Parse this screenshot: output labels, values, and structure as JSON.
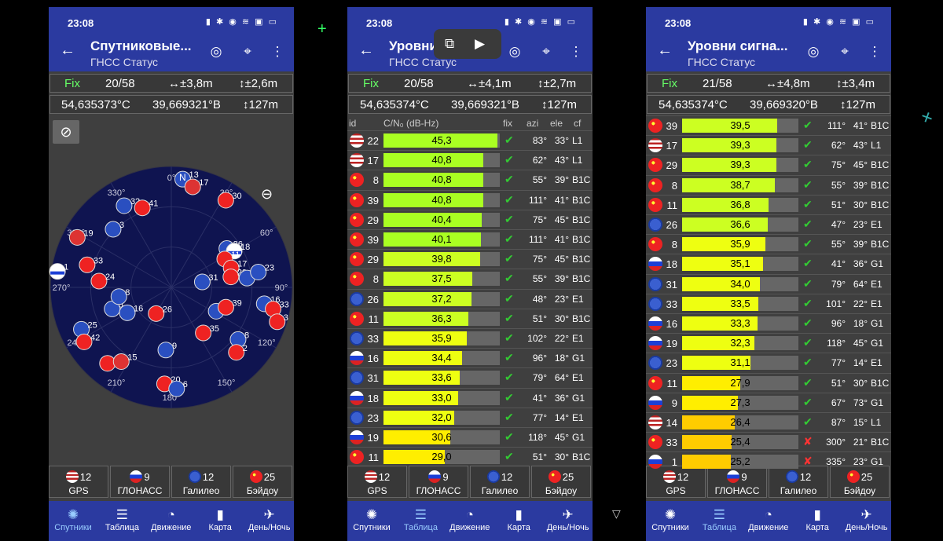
{
  "time": "23:08",
  "screens": [
    {
      "title": "Спутниковые...",
      "subtitle": "ГНСС Статус",
      "fix": {
        "label": "Fix",
        "count": "20/58",
        "h_acc": "↔±3,8m",
        "v_acc": "↕±2,6m"
      },
      "pos": {
        "lat": "54,635373°С",
        "lon": "39,669321°В",
        "alt": "↕127m"
      }
    },
    {
      "title": "Уровни",
      "subtitle": "ГНСС Статус",
      "fix": {
        "label": "Fix",
        "count": "20/58",
        "h_acc": "↔±4,1m",
        "v_acc": "↕±2,7m"
      },
      "pos": {
        "lat": "54,635374°С",
        "lon": "39,669321°В",
        "alt": "↕127m"
      }
    },
    {
      "title": "Уровни сигна...",
      "subtitle": "ГНСС Статус",
      "fix": {
        "label": "Fix",
        "count": "21/58",
        "h_acc": "↔±4,8m",
        "v_acc": "↕±3,4m"
      },
      "pos": {
        "lat": "54,635374°С",
        "lon": "39,669320°В",
        "alt": "↕127m"
      }
    }
  ],
  "table_headers": {
    "id": "id",
    "cn0": "C/N₀ (dB-Hz)",
    "fix": "fix",
    "azi": "azi",
    "ele": "ele",
    "cf": "cf"
  },
  "constellations": [
    {
      "name": "GPS",
      "flag": "us"
    },
    {
      "name": "ГЛОНАСС",
      "flag": "ru"
    },
    {
      "name": "Галилео",
      "flag": "eu"
    },
    {
      "name": "Бэйдоу",
      "flag": "cn"
    }
  ],
  "constellation_counts": [
    [
      "12",
      "9",
      "12",
      "25"
    ],
    [
      "12",
      "9",
      "12",
      "25"
    ],
    [
      "12",
      "9",
      "12",
      "25"
    ]
  ],
  "nav": [
    "Спутники",
    "Таблица",
    "Движение",
    "Карта",
    "День/Ночь"
  ],
  "nav_active": [
    0,
    1,
    1
  ],
  "sky": {
    "ring_labels": [
      "0°",
      "30°",
      "60°",
      "90°",
      "120°",
      "150°",
      "180°",
      "210°",
      "240°",
      "270°",
      "300°",
      "330°"
    ],
    "north": "N",
    "satellites": [
      {
        "id": "13",
        "f": "eu",
        "az": 6,
        "el": 90
      },
      {
        "id": "17",
        "f": "us",
        "az": 12,
        "el": 85
      },
      {
        "id": "32",
        "f": "eu",
        "az": 330,
        "el": 78
      },
      {
        "id": "41",
        "f": "cn",
        "az": 340,
        "el": 70
      },
      {
        "id": "30",
        "f": "cn",
        "az": 32,
        "el": 85
      },
      {
        "id": "3",
        "f": "eu",
        "az": 315,
        "el": 68
      },
      {
        "id": "19",
        "f": "us",
        "az": 298,
        "el": 88
      },
      {
        "id": "33",
        "f": "cn",
        "az": 285,
        "el": 72
      },
      {
        "id": "24",
        "f": "cn",
        "az": 275,
        "el": 60
      },
      {
        "id": "26",
        "f": "eu",
        "az": 55,
        "el": 56
      },
      {
        "id": "18",
        "f": "ru",
        "az": 60,
        "el": 60
      },
      {
        "id": "11",
        "f": "cn",
        "az": 62,
        "el": 50
      },
      {
        "id": "17",
        "f": "cn",
        "az": 72,
        "el": 52
      },
      {
        "id": "29",
        "f": "cn",
        "az": 80,
        "el": 50
      },
      {
        "id": "22",
        "f": "eu",
        "az": 83,
        "el": 63
      },
      {
        "id": "23",
        "f": "eu",
        "az": 80,
        "el": 73
      },
      {
        "id": "5",
        "f": "eu",
        "az": 250,
        "el": 52
      },
      {
        "id": "16",
        "f": "eu",
        "az": 240,
        "el": 42
      },
      {
        "id": "26",
        "f": "cn",
        "az": 210,
        "el": 25
      },
      {
        "id": "8",
        "f": "eu",
        "az": 260,
        "el": 44
      },
      {
        "id": "31",
        "f": "eu",
        "az": 80,
        "el": 26
      },
      {
        "id": "19",
        "f": "eu",
        "az": 118,
        "el": 42
      },
      {
        "id": "39",
        "f": "cn",
        "az": 110,
        "el": 48
      },
      {
        "id": "16",
        "f": "eu",
        "az": 100,
        "el": 78
      },
      {
        "id": "33",
        "f": "cn",
        "az": 102,
        "el": 86
      },
      {
        "id": "3",
        "f": "cn",
        "az": 108,
        "el": 92
      },
      {
        "id": "25",
        "f": "eu",
        "az": 245,
        "el": 82
      },
      {
        "id": "42",
        "f": "cn",
        "az": 238,
        "el": 85
      },
      {
        "id": "35",
        "f": "cn",
        "az": 145,
        "el": 46
      },
      {
        "id": "8",
        "f": "eu",
        "az": 128,
        "el": 70
      },
      {
        "id": "2",
        "f": "cn",
        "az": 135,
        "el": 76
      },
      {
        "id": "9",
        "f": "eu",
        "az": 185,
        "el": 52
      },
      {
        "id": "14",
        "f": "cn",
        "az": 220,
        "el": 82
      },
      {
        "id": "15",
        "f": "us",
        "az": 214,
        "el": 74
      },
      {
        "id": "20",
        "f": "cn",
        "az": 184,
        "el": 80
      },
      {
        "id": "6",
        "f": "eu",
        "az": 177,
        "el": 84
      },
      {
        "id": "1",
        "f": "ru",
        "az": 278,
        "el": 95
      }
    ]
  },
  "table2": [
    {
      "id": "22",
      "f": "us",
      "cn": 45.3,
      "cnt": "45,3",
      "fix": "✔",
      "az": "83°",
      "el": "33°",
      "cf": "L1"
    },
    {
      "id": "17",
      "f": "us",
      "cn": 40.8,
      "cnt": "40,8",
      "fix": "✔",
      "az": "62°",
      "el": "43°",
      "cf": "L1"
    },
    {
      "id": "8",
      "f": "cn",
      "cn": 40.8,
      "cnt": "40,8",
      "fix": "✔",
      "az": "55°",
      "el": "39°",
      "cf": "B1C"
    },
    {
      "id": "39",
      "f": "cn",
      "cn": 40.8,
      "cnt": "40,8",
      "fix": "✔",
      "az": "111°",
      "el": "41°",
      "cf": "B1C"
    },
    {
      "id": "29",
      "f": "cn",
      "cn": 40.4,
      "cnt": "40,4",
      "fix": "✔",
      "az": "75°",
      "el": "45°",
      "cf": "B1C"
    },
    {
      "id": "39",
      "f": "cn",
      "cn": 40.1,
      "cnt": "40,1",
      "fix": "✔",
      "az": "111°",
      "el": "41°",
      "cf": "B1C"
    },
    {
      "id": "29",
      "f": "cn",
      "cn": 39.8,
      "cnt": "39,8",
      "fix": "✔",
      "az": "75°",
      "el": "45°",
      "cf": "B1C"
    },
    {
      "id": "8",
      "f": "cn",
      "cn": 37.5,
      "cnt": "37,5",
      "fix": "✔",
      "az": "55°",
      "el": "39°",
      "cf": "B1C"
    },
    {
      "id": "26",
      "f": "eu",
      "cn": 37.2,
      "cnt": "37,2",
      "fix": "✔",
      "az": "48°",
      "el": "23°",
      "cf": "E1"
    },
    {
      "id": "11",
      "f": "cn",
      "cn": 36.3,
      "cnt": "36,3",
      "fix": "✔",
      "az": "51°",
      "el": "30°",
      "cf": "B1C"
    },
    {
      "id": "33",
      "f": "eu",
      "cn": 35.9,
      "cnt": "35,9",
      "fix": "✔",
      "az": "102°",
      "el": "22°",
      "cf": "E1"
    },
    {
      "id": "16",
      "f": "ru",
      "cn": 34.4,
      "cnt": "34,4",
      "fix": "✔",
      "az": "96°",
      "el": "18°",
      "cf": "G1"
    },
    {
      "id": "31",
      "f": "eu",
      "cn": 33.6,
      "cnt": "33,6",
      "fix": "✔",
      "az": "79°",
      "el": "64°",
      "cf": "E1"
    },
    {
      "id": "18",
      "f": "ru",
      "cn": 33.0,
      "cnt": "33,0",
      "fix": "✔",
      "az": "41°",
      "el": "36°",
      "cf": "G1"
    },
    {
      "id": "23",
      "f": "eu",
      "cn": 32.0,
      "cnt": "32,0",
      "fix": "✔",
      "az": "77°",
      "el": "14°",
      "cf": "E1"
    },
    {
      "id": "19",
      "f": "ru",
      "cn": 30.6,
      "cnt": "30,6",
      "fix": "✔",
      "az": "118°",
      "el": "45°",
      "cf": "G1"
    },
    {
      "id": "11",
      "f": "cn",
      "cn": 29.0,
      "cnt": "29,0",
      "fix": "✔",
      "az": "51°",
      "el": "30°",
      "cf": "B1C"
    }
  ],
  "table3": [
    {
      "id": "39",
      "f": "cn",
      "cn": 39.5,
      "cnt": "39,5",
      "fix": "✔",
      "az": "111°",
      "el": "41°",
      "cf": "B1C"
    },
    {
      "id": "17",
      "f": "us",
      "cn": 39.3,
      "cnt": "39,3",
      "fix": "✔",
      "az": "62°",
      "el": "43°",
      "cf": "L1"
    },
    {
      "id": "29",
      "f": "cn",
      "cn": 39.3,
      "cnt": "39,3",
      "fix": "✔",
      "az": "75°",
      "el": "45°",
      "cf": "B1C"
    },
    {
      "id": "8",
      "f": "cn",
      "cn": 38.7,
      "cnt": "38,7",
      "fix": "✔",
      "az": "55°",
      "el": "39°",
      "cf": "B1C"
    },
    {
      "id": "11",
      "f": "cn",
      "cn": 36.8,
      "cnt": "36,8",
      "fix": "✔",
      "az": "51°",
      "el": "30°",
      "cf": "B1C"
    },
    {
      "id": "26",
      "f": "eu",
      "cn": 36.6,
      "cnt": "36,6",
      "fix": "✔",
      "az": "47°",
      "el": "23°",
      "cf": "E1"
    },
    {
      "id": "8",
      "f": "cn",
      "cn": 35.9,
      "cnt": "35,9",
      "fix": "✔",
      "az": "55°",
      "el": "39°",
      "cf": "B1C"
    },
    {
      "id": "18",
      "f": "ru",
      "cn": 35.1,
      "cnt": "35,1",
      "fix": "✔",
      "az": "41°",
      "el": "36°",
      "cf": "G1"
    },
    {
      "id": "31",
      "f": "eu",
      "cn": 34.0,
      "cnt": "34,0",
      "fix": "✔",
      "az": "79°",
      "el": "64°",
      "cf": "E1"
    },
    {
      "id": "33",
      "f": "eu",
      "cn": 33.5,
      "cnt": "33,5",
      "fix": "✔",
      "az": "101°",
      "el": "22°",
      "cf": "E1"
    },
    {
      "id": "16",
      "f": "ru",
      "cn": 33.3,
      "cnt": "33,3",
      "fix": "✔",
      "az": "96°",
      "el": "18°",
      "cf": "G1"
    },
    {
      "id": "19",
      "f": "ru",
      "cn": 32.3,
      "cnt": "32,3",
      "fix": "✔",
      "az": "118°",
      "el": "45°",
      "cf": "G1"
    },
    {
      "id": "23",
      "f": "eu",
      "cn": 31.1,
      "cnt": "31,1",
      "fix": "✔",
      "az": "77°",
      "el": "14°",
      "cf": "E1"
    },
    {
      "id": "11",
      "f": "cn",
      "cn": 27.9,
      "cnt": "27,9",
      "fix": "✔",
      "az": "51°",
      "el": "30°",
      "cf": "B1C"
    },
    {
      "id": "9",
      "f": "ru",
      "cn": 27.3,
      "cnt": "27,3",
      "fix": "✔",
      "az": "67°",
      "el": "73°",
      "cf": "G1"
    },
    {
      "id": "14",
      "f": "us",
      "cn": 26.4,
      "cnt": "26,4",
      "fix": "✔",
      "az": "87°",
      "el": "15°",
      "cf": "L1"
    },
    {
      "id": "33",
      "f": "cn",
      "cn": 25.4,
      "cnt": "25,4",
      "fix": "✘",
      "az": "300°",
      "el": "21°",
      "cf": "B1C"
    },
    {
      "id": "1",
      "f": "ru",
      "cn": 25.2,
      "cnt": "25,2",
      "fix": "✘",
      "az": "335°",
      "el": "23°",
      "cf": "G1"
    }
  ],
  "colors": {
    "bar_max": "#aaff22",
    "bar_mid": "#ddff22",
    "bar_low": "#ffdd00",
    "bar_weak": "#ffcc00",
    "fix_ok": "#33cc33",
    "fix_no": "#ff3333",
    "accent": "#2b3aa0"
  }
}
